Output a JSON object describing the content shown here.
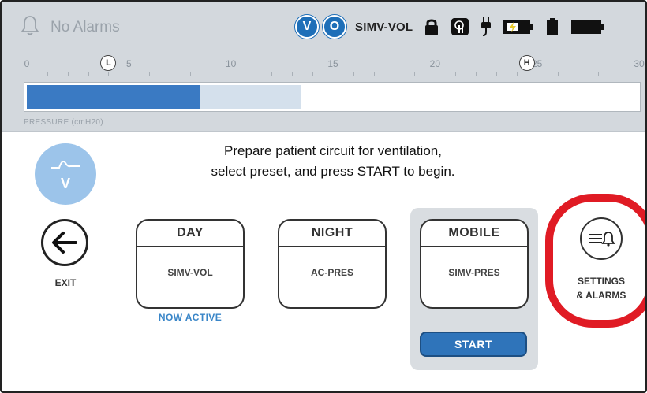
{
  "status_bar": {
    "alarm_text": "No Alarms",
    "badges": [
      "V",
      "O"
    ],
    "mode": "SIMV-VOL",
    "icons": [
      "lock-icon",
      "touch-icon",
      "plug-icon",
      "battery-charging-icon",
      "battery-small-icon",
      "battery-full-icon"
    ]
  },
  "gauge": {
    "ticks": [
      "0",
      "5",
      "10",
      "15",
      "20",
      "25",
      "30"
    ],
    "low_marker": "L",
    "high_marker": "H",
    "low_value": 4,
    "high_value": 24.5,
    "scale_max": 30,
    "current_pressure": 8.5,
    "secondary_level": 13.5,
    "label": "PRESSURE (cmH20)"
  },
  "main": {
    "vent_letter": "V",
    "instruction_line1": "Prepare patient circuit for ventilation,",
    "instruction_line2": "select preset, and press START to begin.",
    "exit_label": "EXIT",
    "presets": [
      {
        "title": "DAY",
        "mode": "SIMV-VOL"
      },
      {
        "title": "NIGHT",
        "mode": "AC-PRES"
      },
      {
        "title": "MOBILE",
        "mode": "SIMV-PRES"
      }
    ],
    "now_active": "NOW ACTIVE",
    "start_label": "START",
    "settings_label": "SETTINGS\n& ALARMS"
  },
  "colors": {
    "accent_blue": "#2f74ba",
    "gauge_fill": "#3a7ac3",
    "highlight_red": "#e01b24",
    "status_bg": "#d3d8dd"
  }
}
